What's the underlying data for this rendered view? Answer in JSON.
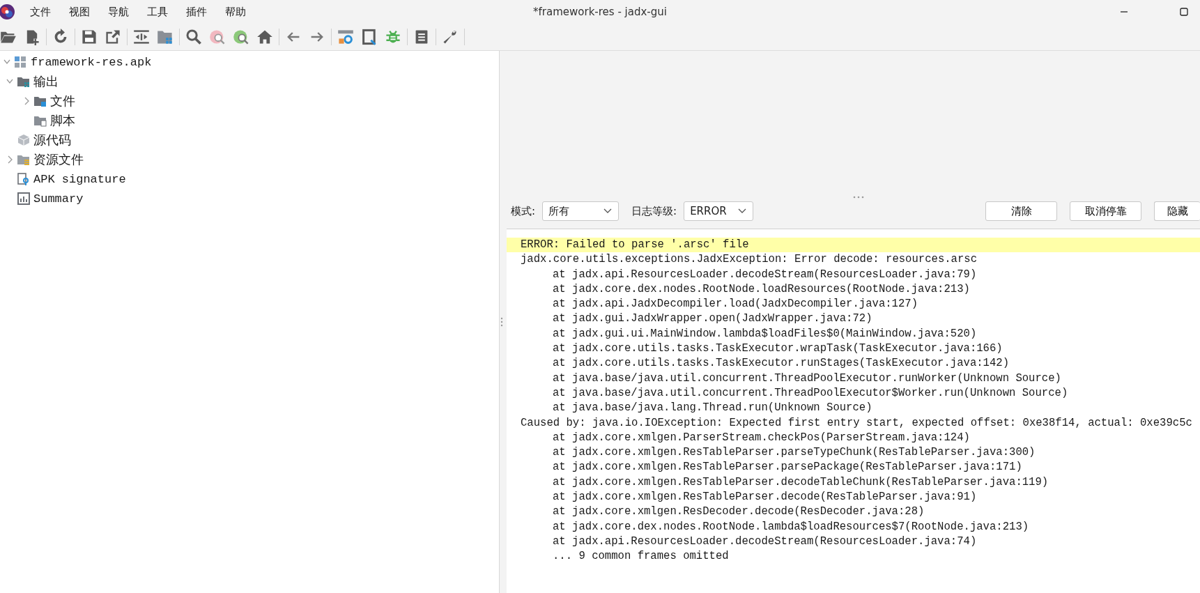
{
  "window": {
    "title": "*framework-res - jadx-gui"
  },
  "menu": [
    "文件",
    "视图",
    "导航",
    "工具",
    "插件",
    "帮助"
  ],
  "tree": [
    {
      "label": "framework-res.apk",
      "kind": "apk",
      "expanded": true,
      "children": [
        {
          "label": "输出",
          "kind": "output",
          "expanded": true,
          "children": [
            {
              "label": "文件",
              "kind": "files",
              "expanded": false
            },
            {
              "label": "脚本",
              "kind": "scripts"
            }
          ]
        },
        {
          "label": "源代码",
          "kind": "source"
        },
        {
          "label": "资源文件",
          "kind": "resources",
          "expanded": false
        },
        {
          "label": "APK signature",
          "kind": "signature"
        },
        {
          "label": "Summary",
          "kind": "summary"
        }
      ]
    }
  ],
  "log_toolbar": {
    "mode_label": "模式:",
    "mode_value": "所有",
    "level_label": "日志等级:",
    "level_value": "ERROR",
    "buttons": [
      "清除",
      "取消停靠",
      "隐藏"
    ]
  },
  "log": [
    {
      "text": "ERROR: Failed to parse '.arsc' file",
      "kind": "message",
      "highlighted": true
    },
    {
      "text": "jadx.core.utils.exceptions.JadxException: Error decode: resources.arsc",
      "kind": "message",
      "highlighted": false
    },
    {
      "text": "at jadx.api.ResourcesLoader.decodeStream(ResourcesLoader.java:79)",
      "kind": "frame",
      "highlighted": false
    },
    {
      "text": "at jadx.core.dex.nodes.RootNode.loadResources(RootNode.java:213)",
      "kind": "frame",
      "highlighted": false
    },
    {
      "text": "at jadx.api.JadxDecompiler.load(JadxDecompiler.java:127)",
      "kind": "frame",
      "highlighted": false
    },
    {
      "text": "at jadx.gui.JadxWrapper.open(JadxWrapper.java:72)",
      "kind": "frame",
      "highlighted": false
    },
    {
      "text": "at jadx.gui.ui.MainWindow.lambda$loadFiles$0(MainWindow.java:520)",
      "kind": "frame",
      "highlighted": false
    },
    {
      "text": "at jadx.core.utils.tasks.TaskExecutor.wrapTask(TaskExecutor.java:166)",
      "kind": "frame",
      "highlighted": false
    },
    {
      "text": "at jadx.core.utils.tasks.TaskExecutor.runStages(TaskExecutor.java:142)",
      "kind": "frame",
      "highlighted": false
    },
    {
      "text": "at java.base/java.util.concurrent.ThreadPoolExecutor.runWorker(Unknown Source)",
      "kind": "frame",
      "highlighted": false
    },
    {
      "text": "at java.base/java.util.concurrent.ThreadPoolExecutor$Worker.run(Unknown Source)",
      "kind": "frame",
      "highlighted": false
    },
    {
      "text": "at java.base/java.lang.Thread.run(Unknown Source)",
      "kind": "frame",
      "highlighted": false
    },
    {
      "text": "Caused by: java.io.IOException: Expected first entry start, expected offset: 0xe38f14, actual: 0xe39c5c",
      "kind": "message",
      "highlighted": false
    },
    {
      "text": "at jadx.core.xmlgen.ParserStream.checkPos(ParserStream.java:124)",
      "kind": "frame",
      "highlighted": false
    },
    {
      "text": "at jadx.core.xmlgen.ResTableParser.parseTypeChunk(ResTableParser.java:300)",
      "kind": "frame",
      "highlighted": false
    },
    {
      "text": "at jadx.core.xmlgen.ResTableParser.parsePackage(ResTableParser.java:171)",
      "kind": "frame",
      "highlighted": false
    },
    {
      "text": "at jadx.core.xmlgen.ResTableParser.decodeTableChunk(ResTableParser.java:119)",
      "kind": "frame",
      "highlighted": false
    },
    {
      "text": "at jadx.core.xmlgen.ResTableParser.decode(ResTableParser.java:91)",
      "kind": "frame",
      "highlighted": false
    },
    {
      "text": "at jadx.core.xmlgen.ResDecoder.decode(ResDecoder.java:28)",
      "kind": "frame",
      "highlighted": false
    },
    {
      "text": "at jadx.core.dex.nodes.RootNode.lambda$loadResources$7(RootNode.java:213)",
      "kind": "frame",
      "highlighted": false
    },
    {
      "text": "at jadx.api.ResourcesLoader.decodeStream(ResourcesLoader.java:74)",
      "kind": "frame",
      "highlighted": false
    },
    {
      "text": "... 9 common frames omitted",
      "kind": "frame",
      "highlighted": false
    }
  ]
}
